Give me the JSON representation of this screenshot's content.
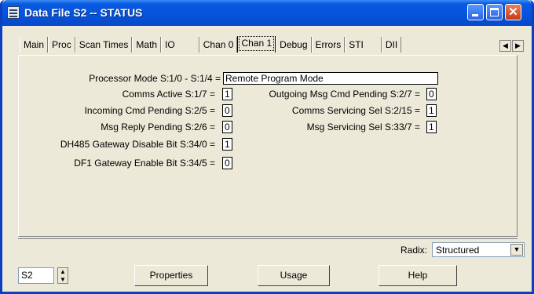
{
  "window": {
    "title": "Data File S2  --  STATUS"
  },
  "tabs": [
    "Main",
    "Proc",
    "Scan Times",
    "Math",
    "IO",
    "Chan 0",
    "Chan 1",
    "Debug",
    "Errors",
    "STI",
    "DII"
  ],
  "active_tab": "Chan 1",
  "fields": {
    "processor_mode": {
      "label": "Processor Mode S:1/0 - S:1/4 =",
      "value": "Remote Program Mode"
    },
    "comms_active": {
      "label": "Comms Active S:1/7 =",
      "value": "1"
    },
    "incoming_cmd_pending": {
      "label": "Incoming Cmd Pending S:2/5 =",
      "value": "0"
    },
    "msg_reply_pending": {
      "label": "Msg Reply Pending S:2/6 =",
      "value": "0"
    },
    "dh485_gateway_disable": {
      "label": "DH485 Gateway Disable Bit S:34/0 =",
      "value": "1"
    },
    "df1_gateway_enable": {
      "label": "DF1 Gateway Enable Bit S:34/5 =",
      "value": "0"
    },
    "outgoing_msg_cmd_pending": {
      "label": "Outgoing Msg Cmd Pending S:2/7 =",
      "value": "0"
    },
    "comms_servicing_sel": {
      "label": "Comms Servicing Sel S:2/15 =",
      "value": "1"
    },
    "msg_servicing_sel": {
      "label": "Msg Servicing Sel S:33/7 =",
      "value": "1"
    }
  },
  "radix": {
    "label": "Radix:",
    "value": "Structured"
  },
  "file_input": {
    "value": "S2"
  },
  "buttons": {
    "properties": "Properties",
    "usage": "Usage",
    "help": "Help"
  }
}
